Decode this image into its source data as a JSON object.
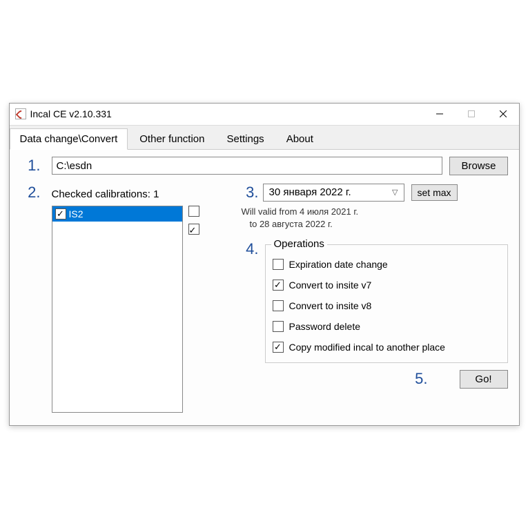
{
  "window": {
    "title": "Incal CE v2.10.331"
  },
  "tabs": [
    "Data change\\Convert",
    "Other function",
    "Settings",
    "About"
  ],
  "tab_active": 0,
  "steps": {
    "s1": "1.",
    "s2": "2.",
    "s3": "3.",
    "s4": "4.",
    "s5": "5."
  },
  "path": {
    "value": "C:\\esdn",
    "browse_label": "Browse"
  },
  "calibrations": {
    "heading": "Checked calibrations: 1",
    "items": [
      {
        "label": "IS2",
        "checked": true,
        "selected": true
      }
    ],
    "side_checks": [
      false,
      true
    ]
  },
  "date": {
    "value": "30  января  2022 г.",
    "setmax_label": "set max",
    "valid_line1": "Will valid from 4 июля 2021 г.",
    "valid_line2": "to 28 августа 2022 г."
  },
  "operations": {
    "legend": "Operations",
    "items": [
      {
        "label": "Expiration date change",
        "checked": false
      },
      {
        "label": "Convert to insite v7",
        "checked": true
      },
      {
        "label": "Convert to insite v8",
        "checked": false
      },
      {
        "label": "Password delete",
        "checked": false
      },
      {
        "label": "Copy modified incal to another place",
        "checked": true
      }
    ]
  },
  "go_label": "Go!"
}
